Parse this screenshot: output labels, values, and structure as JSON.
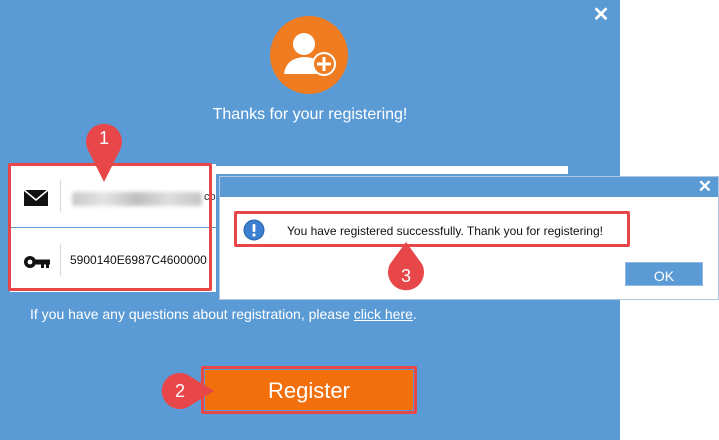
{
  "registration": {
    "thanks_text": "Thanks for your registering!",
    "email_suffix": "co",
    "registration_code": "5900140E6987C4600000",
    "questions_text": "If you have any questions about registration, please ",
    "click_here": "click here",
    "period": ".",
    "register_label": "Register",
    "close_glyph": "✕"
  },
  "dialog": {
    "message": "You have registered successfully. Thank you for registering!",
    "ok_label": "OK",
    "close_glyph": "✕"
  },
  "annotations": [
    {
      "number": "1",
      "target": "registration-fields"
    },
    {
      "number": "2",
      "target": "register-button"
    },
    {
      "number": "3",
      "target": "success-message"
    }
  ],
  "colors": {
    "window_background": "#5b9bd5",
    "avatar_accent": "#f07c22",
    "register_button": "#f36f0c",
    "highlight_frame": "#e8474a",
    "annotation_marker": "#e8474a"
  },
  "icons": [
    "user-add-icon",
    "mail-icon",
    "key-icon",
    "info-icon",
    "close-icon"
  ]
}
